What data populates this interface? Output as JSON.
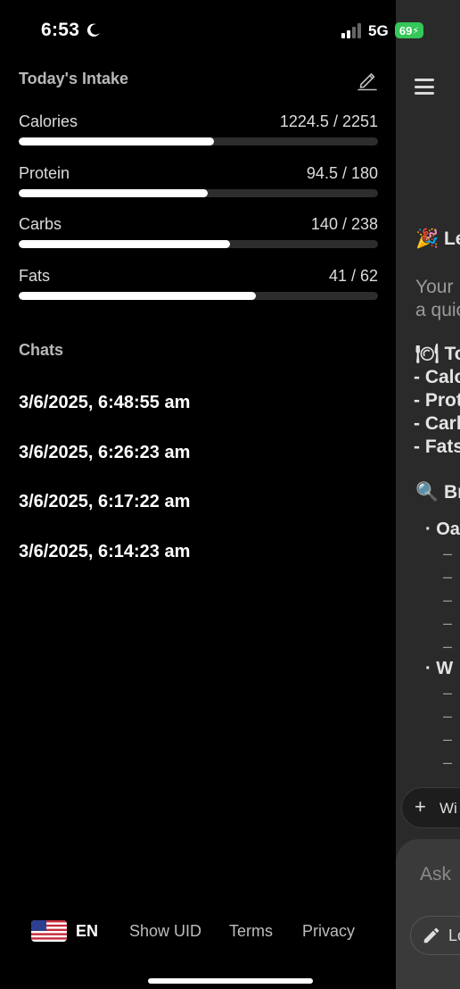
{
  "status_bar": {
    "time": "6:53",
    "network": "5G",
    "battery": "69"
  },
  "intake": {
    "title": "Today's Intake",
    "macros": [
      {
        "label": "Calories",
        "value": "1224.5 / 2251",
        "progress": 0.544
      },
      {
        "label": "Protein",
        "value": "94.5 / 180",
        "progress": 0.525
      },
      {
        "label": "Carbs",
        "value": "140 / 238",
        "progress": 0.588
      },
      {
        "label": "Fats",
        "value": "41 / 62",
        "progress": 0.661
      }
    ]
  },
  "chats": {
    "title": "Chats",
    "items": [
      "3/6/2025, 6:48:55 am",
      "3/6/2025, 6:26:23 am",
      "3/6/2025, 6:17:22 am",
      "3/6/2025, 6:14:23 am"
    ]
  },
  "footer": {
    "language": "EN",
    "show_uid": "Show UID",
    "terms": "Terms",
    "privacy": "Privacy"
  },
  "main_panel": {
    "heading": "🎉 Le",
    "intro_1": "Your",
    "intro_2": "a quic",
    "totals_heading": "🍽 To",
    "totals": [
      "- Calo",
      "- Prot",
      "- Carb",
      "- Fats"
    ],
    "breakdown_heading": "🔍 Br",
    "item_1": "· Oa",
    "item_2": "· W",
    "sub_dash": "–",
    "suggest_label": "Wi",
    "ask_placeholder": "Ask",
    "log_label": "Lo"
  },
  "colors": {
    "accent": "#ffffff",
    "track": "#2d2d2d",
    "battery": "#34c759",
    "panel": "#2a2a2a"
  }
}
